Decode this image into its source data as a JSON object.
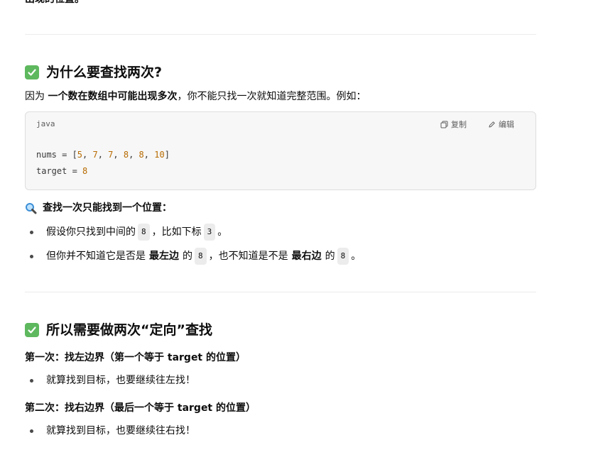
{
  "top_text": "出现的位置。",
  "section1": {
    "heading": "为什么要查找两次?",
    "intro_prefix": "因为",
    "intro_bold": "一个数在数组中可能出现多次",
    "intro_suffix": "，你不能只找一次就知道完整范围。例如：",
    "code": {
      "lang": "java",
      "copy_label": "复制",
      "edit_label": "编辑",
      "line1_var": "nums = [",
      "line1_values": [
        "5",
        "7",
        "7",
        "8",
        "8",
        "10"
      ],
      "line2_var": "target = ",
      "line2_value": "8"
    },
    "search_once_heading": "查找一次只能找到一个位置：",
    "bullet1_pre": "假设你只找到中间的",
    "bullet1_code1": "8",
    "bullet1_mid": "，比如下标",
    "bullet1_code2": "3",
    "bullet1_end": "。",
    "bullet2_pre": "但你并不知道它是否是",
    "bullet2_bold1": "最左边",
    "bullet2_de1": "的",
    "bullet2_code1": "8",
    "bullet2_mid": "，也不知道是不是",
    "bullet2_bold2": "最右边",
    "bullet2_de2": "的",
    "bullet2_code2": "8",
    "bullet2_end": "。"
  },
  "section2": {
    "heading": "所以需要做两次“定向”查找",
    "first_label": "第一次：找左边界（第一个等于 target 的位置）",
    "first_bullet": "就算找到目标，也要继续往左找！",
    "second_label": "第二次：找右边界（最后一个等于 target 的位置）",
    "second_bullet": "就算找到目标，也要继续往右找！"
  },
  "icons": {
    "check": "white-check-mark-emoji-icon",
    "search": "magnifying-glass-emoji-icon",
    "copy": "copy-icon",
    "edit": "pencil-icon"
  },
  "colors": {
    "check_bg": "#5eb85e",
    "code_bg": "#f7f7f7",
    "number": "#b76b01"
  }
}
